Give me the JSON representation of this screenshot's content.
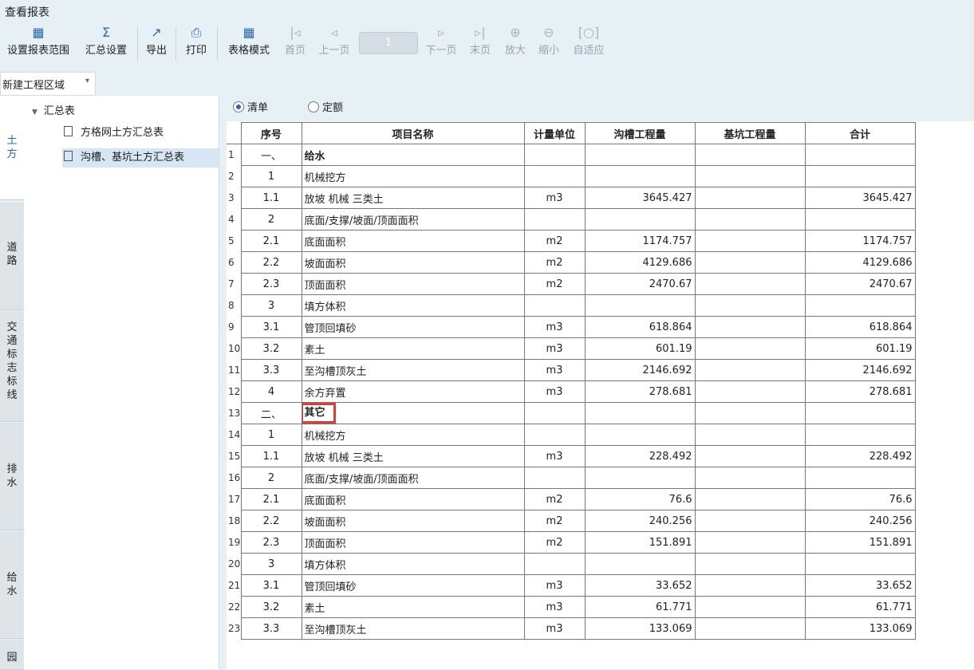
{
  "window": {
    "title": "查看报表"
  },
  "toolbar": {
    "buttons": [
      {
        "label": "设置报表范围",
        "icon": "grid-settings-icon"
      },
      {
        "label": "汇总设置",
        "icon": "sigma-icon"
      },
      {
        "label": "导出",
        "icon": "export-icon"
      },
      {
        "label": "打印",
        "icon": "printer-icon"
      },
      {
        "label": "表格模式",
        "icon": "table-icon"
      },
      {
        "label": "首页",
        "icon": "first-page-icon"
      },
      {
        "label": "上一页",
        "icon": "prev-page-icon"
      },
      {
        "label": "下一页",
        "icon": "next-page-icon"
      },
      {
        "label": "末页",
        "icon": "last-page-icon"
      },
      {
        "label": "放大",
        "icon": "zoom-in-icon"
      },
      {
        "label": "缩小",
        "icon": "zoom-out-icon"
      },
      {
        "label": "自适应",
        "icon": "fit-icon"
      }
    ],
    "page_number": "1"
  },
  "area_select": {
    "value": "新建工程区域"
  },
  "side_tabs": [
    {
      "label": "土方",
      "active": true
    },
    {
      "label": "道路"
    },
    {
      "label": "交通标志标线"
    },
    {
      "label": "排水"
    },
    {
      "label": "给水"
    },
    {
      "label": "园"
    }
  ],
  "tree": {
    "root": "汇总表",
    "items": [
      {
        "label": "方格网土方汇总表"
      },
      {
        "label": "沟槽、基坑土方汇总表",
        "selected": true
      }
    ]
  },
  "radios": [
    {
      "label": "清单",
      "checked": true
    },
    {
      "label": "定额",
      "checked": false
    }
  ],
  "table": {
    "columns": [
      "序号",
      "项目名称",
      "计量单位",
      "沟槽工程量",
      "基坑工程量",
      "合计"
    ],
    "rows": [
      {
        "n": "1",
        "seq": "一、",
        "name": "给水",
        "unit": "",
        "trench": "",
        "pit": "",
        "total": "",
        "section": true
      },
      {
        "n": "2",
        "seq": "1",
        "name": "机械挖方",
        "unit": "",
        "trench": "",
        "pit": "",
        "total": ""
      },
      {
        "n": "3",
        "seq": "1.1",
        "name": "放坡 机械 三类土",
        "unit": "m3",
        "trench": "3645.427",
        "pit": "",
        "total": "3645.427"
      },
      {
        "n": "4",
        "seq": "2",
        "name": "底面/支撑/坡面/顶面面积",
        "unit": "",
        "trench": "",
        "pit": "",
        "total": ""
      },
      {
        "n": "5",
        "seq": "2.1",
        "name": "底面面积",
        "unit": "m2",
        "trench": "1174.757",
        "pit": "",
        "total": "1174.757"
      },
      {
        "n": "6",
        "seq": "2.2",
        "name": "坡面面积",
        "unit": "m2",
        "trench": "4129.686",
        "pit": "",
        "total": "4129.686"
      },
      {
        "n": "7",
        "seq": "2.3",
        "name": "顶面面积",
        "unit": "m2",
        "trench": "2470.67",
        "pit": "",
        "total": "2470.67"
      },
      {
        "n": "8",
        "seq": "3",
        "name": "填方体积",
        "unit": "",
        "trench": "",
        "pit": "",
        "total": ""
      },
      {
        "n": "9",
        "seq": "3.1",
        "name": "管顶回填砂",
        "unit": "m3",
        "trench": "618.864",
        "pit": "",
        "total": "618.864"
      },
      {
        "n": "10",
        "seq": "3.2",
        "name": "素土",
        "unit": "m3",
        "trench": "601.19",
        "pit": "",
        "total": "601.19"
      },
      {
        "n": "11",
        "seq": "3.3",
        "name": "至沟槽顶灰土",
        "unit": "m3",
        "trench": "2146.692",
        "pit": "",
        "total": "2146.692"
      },
      {
        "n": "12",
        "seq": "4",
        "name": "余方弃置",
        "unit": "m3",
        "trench": "278.681",
        "pit": "",
        "total": "278.681"
      },
      {
        "n": "13",
        "seq": "二、",
        "name": "其它",
        "unit": "",
        "trench": "",
        "pit": "",
        "total": "",
        "section": true,
        "highlight": true
      },
      {
        "n": "14",
        "seq": "1",
        "name": "机械挖方",
        "unit": "",
        "trench": "",
        "pit": "",
        "total": ""
      },
      {
        "n": "15",
        "seq": "1.1",
        "name": "放坡 机械 三类土",
        "unit": "m3",
        "trench": "228.492",
        "pit": "",
        "total": "228.492"
      },
      {
        "n": "16",
        "seq": "2",
        "name": "底面/支撑/坡面/顶面面积",
        "unit": "",
        "trench": "",
        "pit": "",
        "total": ""
      },
      {
        "n": "17",
        "seq": "2.1",
        "name": "底面面积",
        "unit": "m2",
        "trench": "76.6",
        "pit": "",
        "total": "76.6"
      },
      {
        "n": "18",
        "seq": "2.2",
        "name": "坡面面积",
        "unit": "m2",
        "trench": "240.256",
        "pit": "",
        "total": "240.256"
      },
      {
        "n": "19",
        "seq": "2.3",
        "name": "顶面面积",
        "unit": "m2",
        "trench": "151.891",
        "pit": "",
        "total": "151.891"
      },
      {
        "n": "20",
        "seq": "3",
        "name": "填方体积",
        "unit": "",
        "trench": "",
        "pit": "",
        "total": ""
      },
      {
        "n": "21",
        "seq": "3.1",
        "name": "管顶回填砂",
        "unit": "m3",
        "trench": "33.652",
        "pit": "",
        "total": "33.652"
      },
      {
        "n": "22",
        "seq": "3.2",
        "name": "素土",
        "unit": "m3",
        "trench": "61.771",
        "pit": "",
        "total": "61.771"
      },
      {
        "n": "23",
        "seq": "3.3",
        "name": "至沟槽顶灰土",
        "unit": "m3",
        "trench": "133.069",
        "pit": "",
        "total": "133.069"
      }
    ]
  }
}
